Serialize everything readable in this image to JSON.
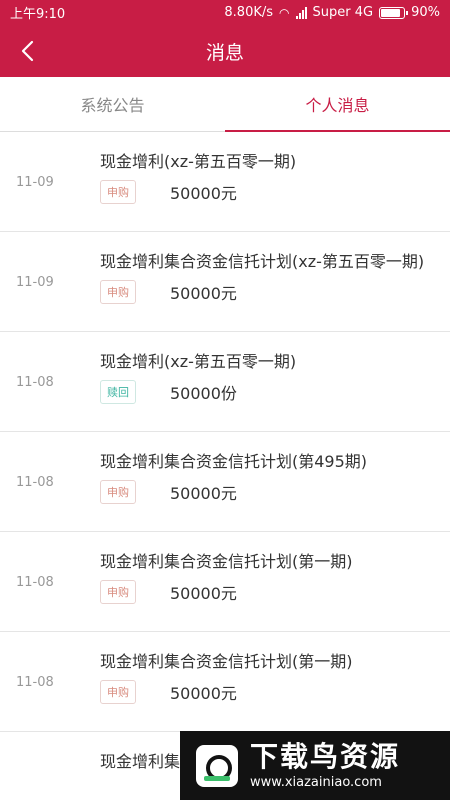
{
  "status_bar": {
    "time": "上午9:10",
    "speed": "8.80K/s",
    "carrier": "Super 4G",
    "battery": "90%"
  },
  "app_bar": {
    "title": "消息",
    "back_icon": "chevron-left-icon"
  },
  "tabs": [
    {
      "label": "系统公告",
      "active": false
    },
    {
      "label": "个人消息",
      "active": true
    }
  ],
  "messages": [
    {
      "date": "11-09",
      "title": "现金增利(xz-第五百零一期)",
      "type": "申购",
      "amount": "50000元"
    },
    {
      "date": "11-09",
      "title": "现金增利集合资金信托计划(xz-第五百零一期)",
      "type": "申购",
      "amount": "50000元"
    },
    {
      "date": "11-08",
      "title": "现金增利(xz-第五百零一期)",
      "type": "赎回",
      "amount": "50000份"
    },
    {
      "date": "11-08",
      "title": "现金增利集合资金信托计划(第495期)",
      "type": "申购",
      "amount": "50000元"
    },
    {
      "date": "11-08",
      "title": "现金增利集合资金信托计划(第一期)",
      "type": "申购",
      "amount": "50000元"
    },
    {
      "date": "11-08",
      "title": "现金增利集合资金信托计划(第一期)",
      "type": "申购",
      "amount": "50000元"
    },
    {
      "date": "",
      "title": "现金增利集",
      "type": "",
      "amount": ""
    }
  ],
  "watermark": {
    "name": "下载鸟资源",
    "url": "www.xiazainiao.com"
  },
  "colors": {
    "brand": "#c81d45",
    "subscribe_badge": "#d88b7e",
    "redeem_badge": "#3fb5a2"
  }
}
